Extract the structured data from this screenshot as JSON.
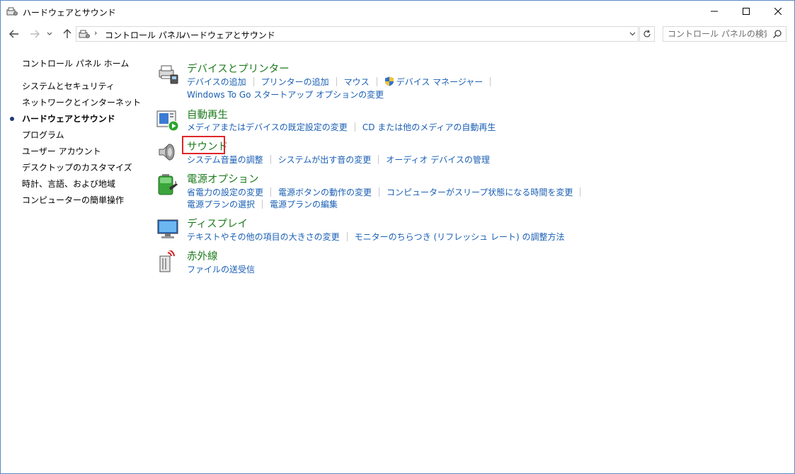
{
  "window": {
    "title": "ハードウェアとサウンド"
  },
  "nav": {
    "breadcrumbs": [
      "コントロール パネル",
      "ハードウェアとサウンド"
    ],
    "search_placeholder": "コントロール パネルの検索"
  },
  "sidebar": {
    "items": [
      {
        "label": "コントロール パネル ホーム",
        "active": false
      },
      {
        "label": "システムとセキュリティ",
        "active": false
      },
      {
        "label": "ネットワークとインターネット",
        "active": false
      },
      {
        "label": "ハードウェアとサウンド",
        "active": true
      },
      {
        "label": "プログラム",
        "active": false
      },
      {
        "label": "ユーザー アカウント",
        "active": false
      },
      {
        "label": "デスクトップのカスタマイズ",
        "active": false
      },
      {
        "label": "時計、言語、および地域",
        "active": false
      },
      {
        "label": "コンピューターの簡単操作",
        "active": false
      }
    ]
  },
  "categories": [
    {
      "title": "デバイスとプリンター",
      "icon": "printer-icon",
      "tasks": [
        "デバイスの追加",
        "プリンターの追加",
        "マウス",
        "デバイス マネージャー",
        "Windows To Go スタートアップ オプションの変更"
      ]
    },
    {
      "title": "自動再生",
      "icon": "autoplay-icon",
      "tasks": [
        "メディアまたはデバイスの既定設定の変更",
        "CD または他のメディアの自動再生"
      ]
    },
    {
      "title": "サウンド",
      "icon": "speaker-icon",
      "tasks": [
        "システム音量の調整",
        "システムが出す音の変更",
        "オーディオ デバイスの管理"
      ]
    },
    {
      "title": "電源オプション",
      "icon": "battery-icon",
      "tasks": [
        "省電力の設定の変更",
        "電源ボタンの動作の変更",
        "コンピューターがスリープ状態になる時間を変更",
        "電源プランの選択",
        "電源プランの編集"
      ]
    },
    {
      "title": "ディスプレイ",
      "icon": "monitor-icon",
      "tasks": [
        "テキストやその他の項目の大きさの変更",
        "モニターのちらつき (リフレッシュ レート) の調整方法"
      ]
    },
    {
      "title": "赤外線",
      "icon": "infrared-icon",
      "tasks": [
        "ファイルの送受信"
      ]
    }
  ],
  "colors": {
    "category_title": "#1e7b1e",
    "task_link": "#1a5fb4",
    "highlight": "#e0262b"
  }
}
